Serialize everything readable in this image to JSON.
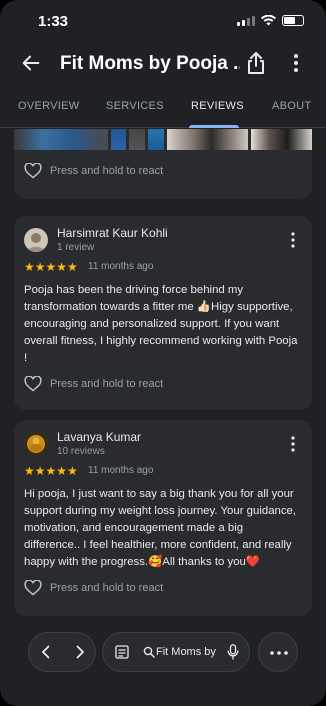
{
  "status_bar": {
    "time": "1:33"
  },
  "header": {
    "title": "Fit Moms by Pooja ..."
  },
  "tabs": [
    {
      "label": "OVERVIEW"
    },
    {
      "label": "SERVICES"
    },
    {
      "label": "REVIEWS",
      "active": true
    },
    {
      "label": "ABOUT"
    }
  ],
  "prev_card": {
    "react_label": "Press and hold to react"
  },
  "reviews": [
    {
      "name": "Harsimrat Kaur Kohli",
      "meta": "1 review",
      "stars": "★★★★★",
      "rating": 5,
      "time_ago": "11 months ago",
      "text": "Pooja has been the driving force behind my transformation towards a fitter me 👍🏻Higy supportive, encouraging and personalized support. If you want overall fitness, I highly recommend working with Pooja !",
      "react_label": "Press and hold to react"
    },
    {
      "name": "Lavanya Kumar",
      "meta": "10 reviews",
      "stars": "★★★★★",
      "rating": 5,
      "time_ago": "11 months ago",
      "text": "Hi pooja, I just want to say a big thank you for all your support during my weight loss journey. Your guidance, motivation, and encouragement made a big difference.. I feel healthier, more confident, and really happy with the progress.🥰All thanks to you❤️",
      "react_label": "Press and hold to react"
    }
  ],
  "toolbar": {
    "address_text": "Fit Moms by"
  },
  "colors": {
    "background": "#202124",
    "card": "#2a2b2e",
    "star": "#fbbc04",
    "accent": "#8ab4f8"
  }
}
